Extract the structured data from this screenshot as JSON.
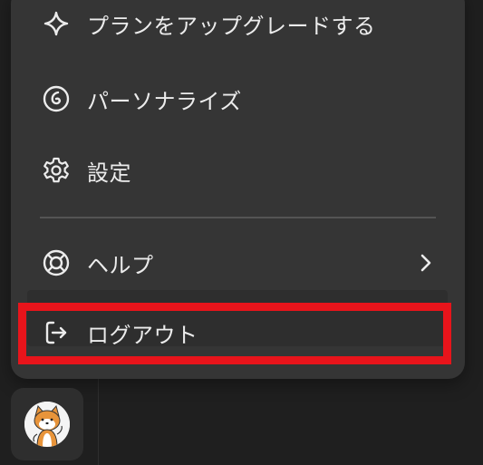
{
  "menu": {
    "items": [
      {
        "label": "プランをアップグレードする",
        "icon": "sparkle-icon"
      },
      {
        "label": "パーソナライズ",
        "icon": "personalize-icon"
      },
      {
        "label": "設定",
        "icon": "gear-icon"
      },
      {
        "label": "ヘルプ",
        "icon": "lifebuoy-icon",
        "submenu": true
      },
      {
        "label": "ログアウト",
        "icon": "logout-icon"
      }
    ]
  },
  "colors": {
    "menu_bg": "#353535",
    "page_bg": "#1f1f1f",
    "text": "#ececec",
    "highlight": "#e8141b"
  },
  "avatar": {
    "icon": "user-avatar"
  }
}
